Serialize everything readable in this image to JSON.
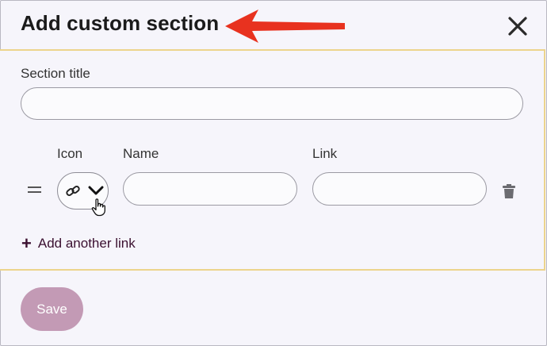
{
  "dialog": {
    "title": "Add custom section",
    "close_icon": "close-icon"
  },
  "form": {
    "section_title_label": "Section title",
    "section_title_value": "",
    "columns": {
      "icon": "Icon",
      "name": "Name",
      "link": "Link"
    },
    "link_row": {
      "icon": "link-icon",
      "name_value": "",
      "link_value": ""
    },
    "add_link_label": "Add another link"
  },
  "footer": {
    "save_label": "Save"
  },
  "colors": {
    "accent_border": "#ecd48c",
    "save_button": "#c39ab5",
    "annotation_arrow": "#e8321f"
  }
}
